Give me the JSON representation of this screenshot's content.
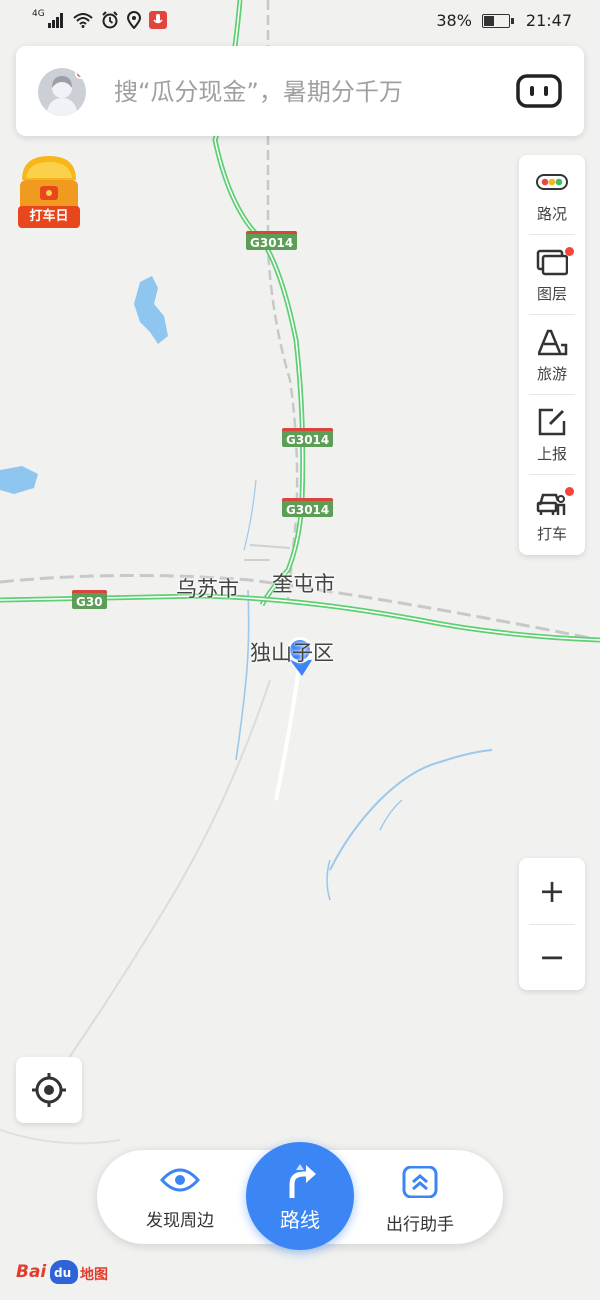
{
  "status_bar": {
    "network": "4G",
    "battery_percent": "38%",
    "battery_level": 0.38,
    "time": "21:47"
  },
  "search": {
    "placeholder": "搜“瓜分现金”，暑期分千万"
  },
  "promo": {
    "label": "打车日"
  },
  "side_tools": [
    {
      "label": "路况",
      "icon": "traffic-light-icon"
    },
    {
      "label": "图层",
      "icon": "layers-icon"
    },
    {
      "label": "旅游",
      "icon": "travel-icon"
    },
    {
      "label": "上报",
      "icon": "report-edit-icon"
    },
    {
      "label": "打车",
      "icon": "taxi-icon"
    }
  ],
  "zoom": {
    "in": "+",
    "out": "−"
  },
  "map": {
    "cities": [
      {
        "name": "乌苏市"
      },
      {
        "name": "奎屯市"
      },
      {
        "name": "独山子区"
      }
    ],
    "highways": [
      {
        "code": "G3014"
      },
      {
        "code": "G3014"
      },
      {
        "code": "G3014"
      },
      {
        "code": "G30"
      }
    ]
  },
  "bottom_nav": {
    "discover_label": "发现周边",
    "route_label": "路线",
    "assistant_label": "出行助手"
  },
  "logo": {
    "text_left": "Bai",
    "text_paw": "du",
    "text_right": "地图"
  },
  "colors": {
    "accent": "#3b85f5",
    "road_green": "#5fcf73",
    "shield_green": "#5d9e56",
    "alert_red": "#f4453a",
    "water": "#8fc6f0",
    "map_bg": "#f1f1ef"
  }
}
